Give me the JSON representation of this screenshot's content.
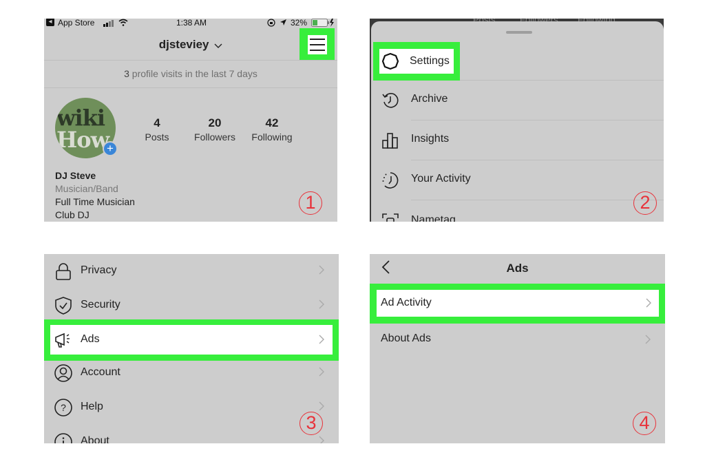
{
  "colors": {
    "highlight": "#37ee3c",
    "step_marker": "#e8323a",
    "panel_bg": "#cdcdcd"
  },
  "panel1": {
    "status_bar": {
      "back_app": "App Store",
      "time": "1:38 AM",
      "battery": "32%"
    },
    "username": "djsteviey",
    "menu_icon": "hamburger-menu-icon",
    "visits_count": "3",
    "visits_text": " profile visits in the last 7 days",
    "avatar_text": [
      "wiki",
      "How"
    ],
    "add_badge": "+",
    "stats": [
      {
        "value": "4",
        "label": "Posts"
      },
      {
        "value": "20",
        "label": "Followers"
      },
      {
        "value": "42",
        "label": "Following"
      }
    ],
    "bio": {
      "name": "DJ Steve",
      "category": "Musician/Band",
      "lines": [
        "Full Time Musician",
        "Club DJ"
      ]
    },
    "step": "1"
  },
  "panel2": {
    "behind_labels": [
      "Posts",
      "Followers",
      "Following"
    ],
    "menu": [
      {
        "label": "Settings",
        "icon": "settings-gear-icon",
        "highlighted": true
      },
      {
        "label": "Archive",
        "icon": "archive-history-icon"
      },
      {
        "label": "Insights",
        "icon": "insights-bar-chart-icon"
      },
      {
        "label": "Your Activity",
        "icon": "activity-clock-icon"
      },
      {
        "label": "Nametag",
        "icon": "nametag-scan-icon"
      }
    ],
    "step": "2"
  },
  "panel3": {
    "items": [
      {
        "label": "Privacy",
        "icon": "lock-icon"
      },
      {
        "label": "Security",
        "icon": "shield-check-icon"
      },
      {
        "label": "Ads",
        "icon": "megaphone-icon",
        "highlighted": true
      },
      {
        "label": "Account",
        "icon": "user-circle-icon"
      },
      {
        "label": "Help",
        "icon": "help-question-icon"
      },
      {
        "label": "About",
        "icon": "info-icon"
      }
    ],
    "step": "3"
  },
  "panel4": {
    "title": "Ads",
    "items": [
      {
        "label": "Ad Activity",
        "highlighted": true
      },
      {
        "label": "About Ads"
      }
    ],
    "step": "4"
  }
}
